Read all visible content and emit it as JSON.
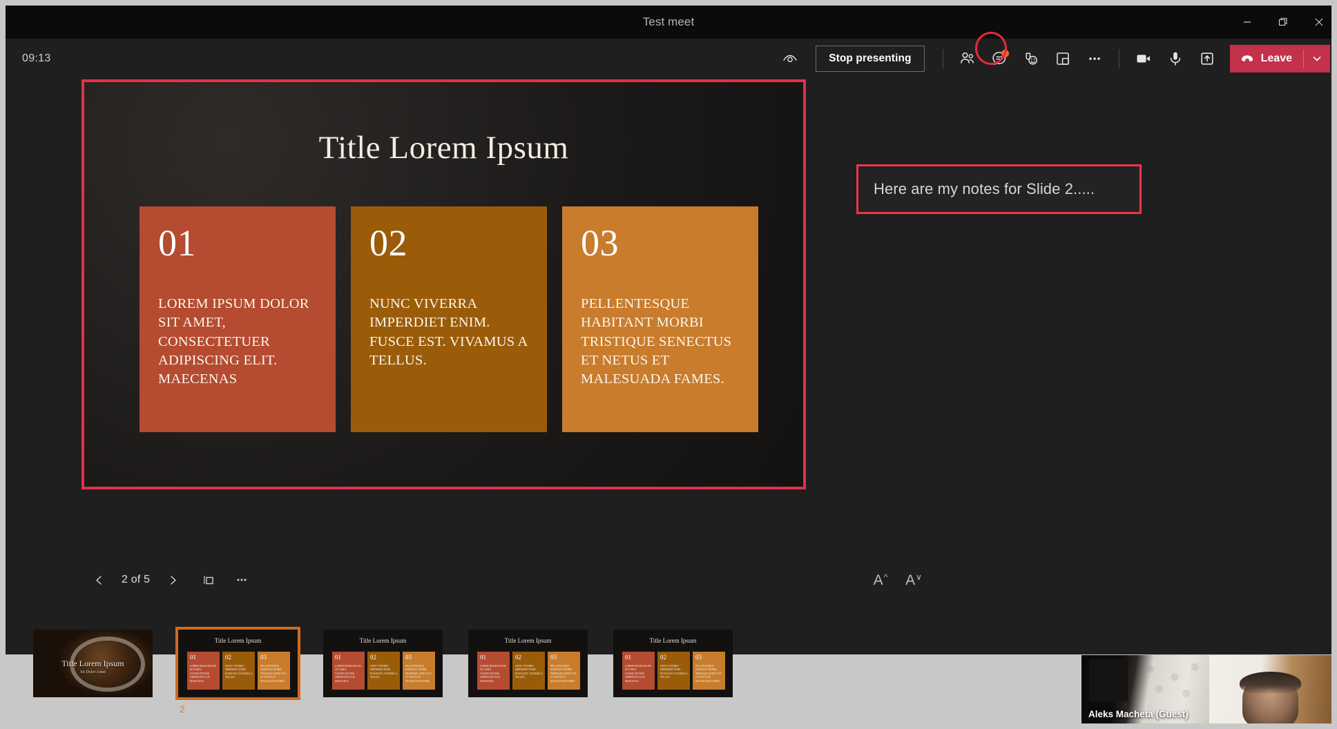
{
  "window": {
    "title": "Test meet",
    "minimize_icon": "minimize-icon",
    "restore_icon": "restore-icon",
    "close_icon": "close-icon"
  },
  "toolbar": {
    "clock": "09:13",
    "eye_icon": "eye-icon",
    "stop_presenting_label": "Stop presenting",
    "people_icon": "people-icon",
    "chat_icon": "chat-icon",
    "chat_badge": true,
    "reactions_icon": "reactions-icon",
    "breakout_icon": "breakout-rooms-icon",
    "more_icon": "more-options-icon",
    "camera_icon": "camera-icon",
    "mic_icon": "microphone-icon",
    "share_icon": "share-tray-icon",
    "leave_label": "Leave",
    "leave_chevron_icon": "chevron-down-icon",
    "leave_color": "#c4314b",
    "chat_highlight_color": "#e8283c",
    "badge_color": "#f2682a"
  },
  "slide": {
    "highlight_color": "#e33049",
    "title": "Title Lorem Ipsum",
    "cards": [
      {
        "number": "01",
        "text": "LOREM IPSUM DOLOR SIT AMET, CONSECTETUER ADIPISCING ELIT. MAECENAS",
        "color": "#b54b30"
      },
      {
        "number": "02",
        "text": "NUNC VIVERRA IMPERDIET ENIM. FUSCE EST. VIVAMUS A TELLUS.",
        "color": "#9b5c0a"
      },
      {
        "number": "03",
        "text": "PELLENTESQUE HABITANT MORBI TRISTIQUE SENECTUS ET NETUS ET MALESUADA FAMES.",
        "color": "#c87c2c"
      }
    ]
  },
  "slide_nav": {
    "prev_icon": "chevron-left-icon",
    "counter": "2 of 5",
    "next_icon": "chevron-right-icon",
    "thumbnails_icon": "all-slides-icon",
    "more_icon": "more-options-icon"
  },
  "notes": {
    "text": "Here are my notes for Slide 2.....",
    "highlight_color": "#f2344b",
    "increase_font_label": "A",
    "increase_font_icon": "chevron-up-icon",
    "decrease_font_label": "A",
    "decrease_font_icon": "chevron-down-icon"
  },
  "thumbnails": {
    "selected_index": 2,
    "selected_color": "#d2691e",
    "items": [
      {
        "number": "1",
        "kind": "cover",
        "title": "Title Lorem Ipsum",
        "subtitle": "Sit Dolor Amet"
      },
      {
        "number": "2",
        "kind": "cards",
        "title": "Title Lorem Ipsum",
        "cards": [
          {
            "number": "01",
            "text": "LOREM IPSUM DOLOR SIT AMET, CONSECTETUER ADIPISCING ELIT. MAECENAS",
            "color": "#b54b30"
          },
          {
            "number": "02",
            "text": "NUNC VIVERRA IMPERDIET ENIM. FUSCE EST. VIVAMUS A TELLUS.",
            "color": "#9b5c0a"
          },
          {
            "number": "03",
            "text": "PELLENTESQUE HABITANT MORBI TRISTIQUE SENECTUS ET NETUS ET MALESUADA FAMES.",
            "color": "#c87c2c"
          }
        ]
      },
      {
        "number": "3",
        "kind": "cards",
        "title": "Title Lorem Ipsum",
        "cards": [
          {
            "number": "01",
            "text": "LOREM IPSUM DOLOR SIT AMET, CONSECTETUER ADIPISCING ELIT. MAECENAS",
            "color": "#b54b30"
          },
          {
            "number": "02",
            "text": "NUNC VIVERRA IMPERDIET ENIM. FUSCE EST. VIVAMUS A TELLUS.",
            "color": "#9b5c0a"
          },
          {
            "number": "03",
            "text": "PELLENTESQUE HABITANT MORBI TRISTIQUE SENECTUS ET NETUS ET MALESUADA FAMES.",
            "color": "#c87c2c"
          }
        ]
      },
      {
        "number": "4",
        "kind": "cards",
        "title": "Title Lorem Ipsum",
        "cards": [
          {
            "number": "01",
            "text": "LOREM IPSUM DOLOR SIT AMET, CONSECTETUER ADIPISCING ELIT. MAECENAS",
            "color": "#b54b30"
          },
          {
            "number": "02",
            "text": "NUNC VIVERRA IMPERDIET ENIM. FUSCE EST. VIVAMUS A TELLUS.",
            "color": "#9b5c0a"
          },
          {
            "number": "03",
            "text": "PELLENTESQUE HABITANT MORBI TRISTIQUE SENECTUS ET NETUS ET MALESUADA FAMES.",
            "color": "#c87c2c"
          }
        ]
      },
      {
        "number": "5",
        "kind": "cards",
        "title": "Title Lorem Ipsum",
        "cards": [
          {
            "number": "01",
            "text": "LOREM IPSUM DOLOR SIT AMET, CONSECTETUER ADIPISCING ELIT. MAECENAS",
            "color": "#b54b30"
          },
          {
            "number": "02",
            "text": "NUNC VIVERRA IMPERDIET ENIM. FUSCE EST. VIVAMUS A TELLUS.",
            "color": "#9b5c0a"
          },
          {
            "number": "03",
            "text": "PELLENTESQUE HABITANT MORBI TRISTIQUE SENECTUS ET NETUS ET MALESUADA FAMES.",
            "color": "#c87c2c"
          }
        ]
      }
    ]
  },
  "video_tiles": [
    {
      "label": "Aleks Macheta (Guest)"
    },
    {
      "label": ""
    }
  ]
}
